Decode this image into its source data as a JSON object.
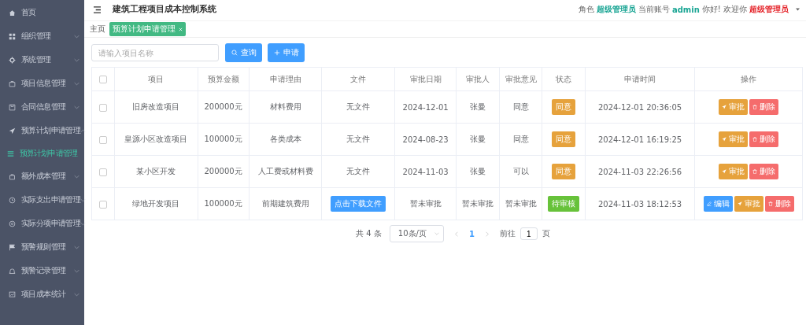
{
  "sidebar": {
    "items": [
      {
        "label": "首页",
        "kind": "link",
        "selected": false
      },
      {
        "label": "组织管理",
        "kind": "group",
        "expanded": false,
        "selected": false
      },
      {
        "label": "系统管理",
        "kind": "group",
        "expanded": false,
        "selected": false
      },
      {
        "label": "项目信息管理",
        "kind": "group",
        "expanded": false,
        "selected": false
      },
      {
        "label": "合同信息管理",
        "kind": "group",
        "expanded": false,
        "selected": false
      },
      {
        "label": "预算计划申请管理",
        "kind": "group",
        "expanded": true,
        "selected": false,
        "children": [
          {
            "label": "预算计划申请管理",
            "selected": true
          }
        ]
      },
      {
        "label": "额外成本管理",
        "kind": "group",
        "expanded": false,
        "selected": false
      },
      {
        "label": "实际支出申请管理",
        "kind": "group",
        "expanded": false,
        "selected": false
      },
      {
        "label": "实际分项申请管理",
        "kind": "group",
        "expanded": false,
        "selected": false
      },
      {
        "label": "预警规则管理",
        "kind": "group",
        "expanded": false,
        "selected": false
      },
      {
        "label": "预警记录管理",
        "kind": "group",
        "expanded": false,
        "selected": false
      },
      {
        "label": "项目成本统计",
        "kind": "group",
        "expanded": false,
        "selected": false
      }
    ]
  },
  "header": {
    "title": "建筑工程项目成本控制系统",
    "user_info": [
      {
        "text": "角色",
        "kind": "label"
      },
      {
        "text": "超级管理员",
        "kind": "value"
      },
      {
        "text": "当前账号",
        "kind": "label"
      },
      {
        "text": "admin",
        "kind": "value"
      },
      {
        "text": "你好! 欢迎你",
        "kind": "label"
      },
      {
        "text": "超级管理员",
        "kind": "highlight"
      }
    ]
  },
  "breadcrumbs": {
    "home": "主页",
    "tabs": [
      {
        "label": "预算计划申请管理",
        "selected": true
      }
    ]
  },
  "toolbar": {
    "search": {
      "placeholder": "请输入项目名称"
    },
    "buttons": [
      {
        "label": "查询",
        "kind": "search"
      },
      {
        "label": "申请",
        "kind": "add"
      }
    ]
  },
  "table": {
    "header_checked": false,
    "columns": [
      "项目",
      "预算金额",
      "申请理由",
      "文件",
      "审批日期",
      "审批人",
      "审批意见",
      "状态",
      "申请时间",
      "操作"
    ],
    "rows": [
      {
        "checked": false,
        "project": "旧房改造项目",
        "budget": "200000元",
        "reason": "材料费用",
        "file": {
          "kind": "none",
          "text": "无文件"
        },
        "approval_date": "2024-12-01",
        "approver": "张曼",
        "opinion": "同意",
        "status": {
          "kind": "approved",
          "label": "同意"
        },
        "applied_at": "2024-12-01 20:36:05",
        "actions": [
          {
            "kind": "approve",
            "label": "审批"
          },
          {
            "kind": "delete",
            "label": "删除"
          }
        ]
      },
      {
        "checked": false,
        "project": "皇源小区改造项目",
        "budget": "100000元",
        "reason": "各类成本",
        "file": {
          "kind": "none",
          "text": "无文件"
        },
        "approval_date": "2024-08-23",
        "approver": "张曼",
        "opinion": "同意",
        "status": {
          "kind": "approved",
          "label": "同意"
        },
        "applied_at": "2024-12-01 16:19:25",
        "actions": [
          {
            "kind": "approve",
            "label": "审批"
          },
          {
            "kind": "delete",
            "label": "删除"
          }
        ]
      },
      {
        "checked": false,
        "project": "某小区开发",
        "budget": "200000元",
        "reason": "人工费或材料费",
        "file": {
          "kind": "none",
          "text": "无文件"
        },
        "approval_date": "2024-11-03",
        "approver": "张曼",
        "opinion": "可以",
        "status": {
          "kind": "approved",
          "label": "同意"
        },
        "applied_at": "2024-11-03 22:26:56",
        "actions": [
          {
            "kind": "approve",
            "label": "审批"
          },
          {
            "kind": "delete",
            "label": "删除"
          }
        ]
      },
      {
        "checked": false,
        "project": "绿地开发项目",
        "budget": "100000元",
        "reason": "前期建筑费用",
        "file": {
          "kind": "download",
          "text": "点击下载文件"
        },
        "approval_date": "暂未审批",
        "approver": "暂未审批",
        "opinion": "暂未审批",
        "status": {
          "kind": "pending",
          "label": "待审核"
        },
        "applied_at": "2024-11-03 18:12:53",
        "actions": [
          {
            "kind": "edit",
            "label": "编辑"
          },
          {
            "kind": "approve",
            "label": "审批"
          },
          {
            "kind": "delete",
            "label": "删除"
          }
        ]
      }
    ]
  },
  "pagination": {
    "total": "共 4 条",
    "page_size": "10条/页",
    "pages": [
      {
        "label": "1",
        "selected": true
      }
    ],
    "goto_label": "前往",
    "goto_value": "1",
    "goto_suffix": "页"
  }
}
